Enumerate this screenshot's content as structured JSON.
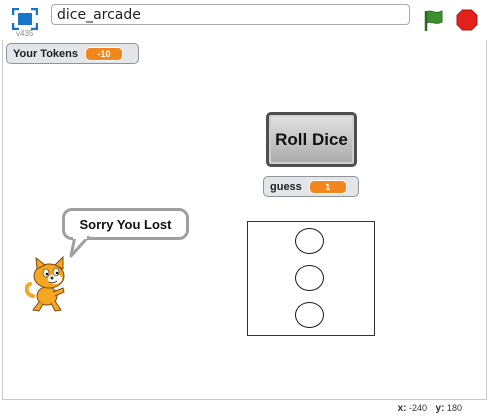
{
  "toolbar": {
    "project_title": "dice_arcade",
    "version": "v435",
    "fullscreen_icon": "fullscreen-icon",
    "green_flag_icon": "green-flag-icon",
    "stop_icon": "stop-sign-icon",
    "colors": {
      "flag": "#3f8f2f",
      "stop": "#e4201c",
      "fullscreen": "#1a74c8"
    }
  },
  "stage": {
    "tokens_monitor": {
      "label": "Your Tokens",
      "value": "-10"
    },
    "guess_monitor": {
      "label": "guess",
      "value": "1"
    },
    "roll_button": {
      "label": "Roll Dice"
    },
    "speech_bubble": {
      "text": "Sorry You Lost"
    },
    "dice_face_pips": 3,
    "cat_sprite": "scratch-cat-sprite",
    "colors": {
      "monitor_value": "#f2871d",
      "cat": "#f5a623"
    }
  },
  "coordinates": {
    "x_label": "x:",
    "x_value": "-240",
    "y_label": "y:",
    "y_value": "180"
  }
}
